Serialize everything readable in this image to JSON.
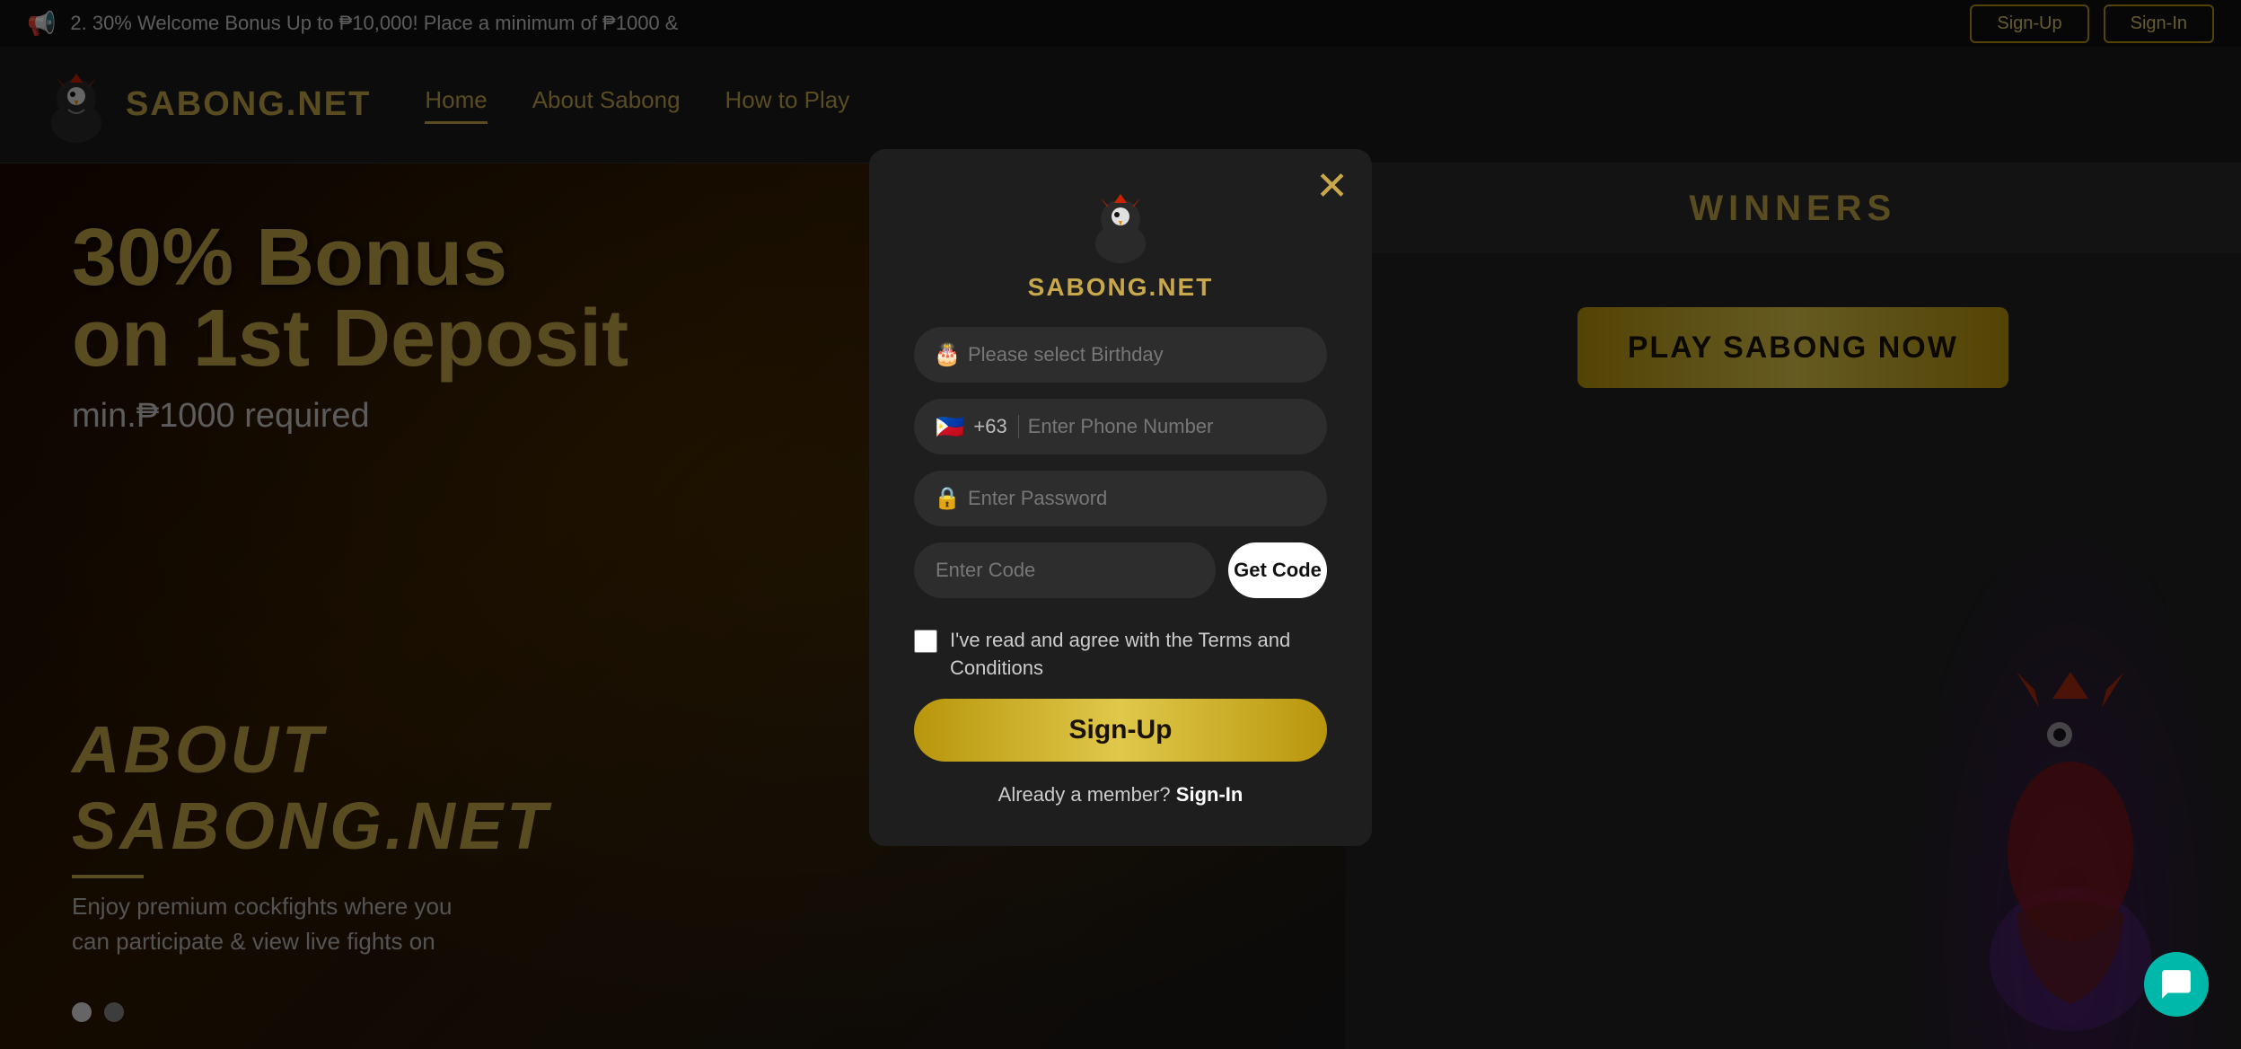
{
  "announce": {
    "text": "2. 30% Welcome Bonus Up to ₱10,000! Place a minimum of ₱1000 &",
    "signup_label": "Sign-Up",
    "signin_label": "Sign-In"
  },
  "navbar": {
    "logo_text": "SABONG.NET",
    "links": [
      {
        "label": "Home",
        "active": true
      },
      {
        "label": "About Sabong",
        "active": false
      },
      {
        "label": "How to Play",
        "active": false
      }
    ]
  },
  "hero": {
    "line1": "30% Bonus",
    "line2": "on 1st Deposit",
    "line3": "min.₱1000 required"
  },
  "about": {
    "title": "ABOUT\nSABONG.NET",
    "body": "Enjoy premium cockfights where you\ncan participate & view live fights on"
  },
  "right": {
    "winners_label": "WINNERS",
    "play_btn_label": "PLAY SABONG NOW"
  },
  "modal": {
    "logo_text": "SABONG.NET",
    "close_icon": "✕",
    "birthday_placeholder": "Please select Birthday",
    "phone_code": "+63",
    "phone_flag": "🇵🇭",
    "phone_placeholder": "Enter Phone Number",
    "password_placeholder": "Enter Password",
    "code_placeholder": "Enter Code",
    "get_code_label": "Get Code",
    "terms_text": "I've read and agree with the Terms and Conditions",
    "signup_label": "Sign-Up",
    "already_member": "Already a member?",
    "signin_link": "Sign-In"
  },
  "chat": {
    "icon": "chat"
  }
}
